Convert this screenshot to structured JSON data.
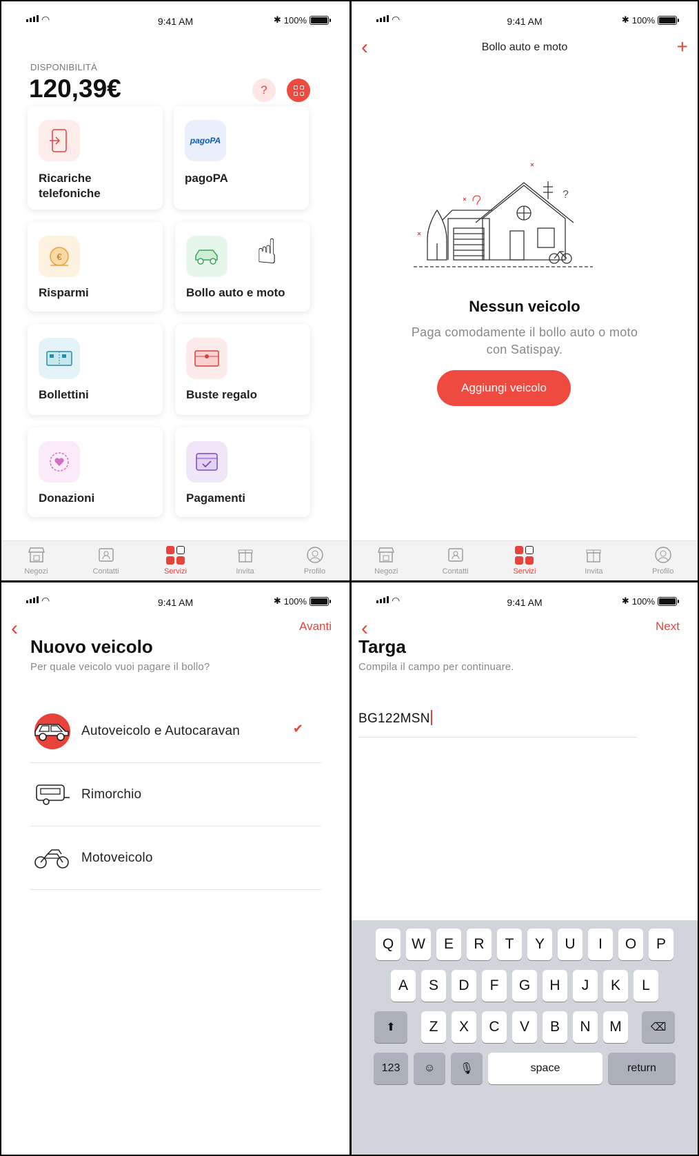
{
  "status_bar": {
    "time": "9:41 AM",
    "battery": "100%",
    "bluetooth": "✱"
  },
  "screen1": {
    "balance_label": "DISPONIBILITÀ",
    "balance_amount": "120,39€",
    "help_label": "?",
    "cards": [
      {
        "label_line1": "Ricariche",
        "label_line2": "telefoniche",
        "icon": "phone-recharge-icon"
      },
      {
        "label_line1": "pagoPA",
        "label_line2": "",
        "icon": "pagopa-logo",
        "logo_text": "pagoPA"
      },
      {
        "label_line1": "Risparmi",
        "label_line2": "",
        "icon": "savings-coin-icon"
      },
      {
        "label_line1": "Bollo auto e moto",
        "label_line2": "",
        "icon": "car-icon"
      },
      {
        "label_line1": "Bollettini",
        "label_line2": "",
        "icon": "bill-slip-icon"
      },
      {
        "label_line1": "Buste regalo",
        "label_line2": "",
        "icon": "gift-envelope-icon"
      },
      {
        "label_line1": "Donazioni",
        "label_line2": "",
        "icon": "heart-donation-icon"
      },
      {
        "label_line1": "Pagamenti",
        "label_line2": "",
        "icon": "calendar-payment-icon"
      }
    ]
  },
  "tabs": [
    {
      "label": "Negozi",
      "icon": "shop-icon"
    },
    {
      "label": "Contatti",
      "icon": "contacts-icon"
    },
    {
      "label": "Servizi",
      "icon": "services-icon",
      "active": true
    },
    {
      "label": "Invita",
      "icon": "gift-icon"
    },
    {
      "label": "Profilo",
      "icon": "profile-icon"
    }
  ],
  "screen2": {
    "title": "Bollo auto e moto",
    "empty_title": "Nessun veicolo",
    "empty_desc_line1": "Paga comodamente il bollo auto o moto",
    "empty_desc_line2": "con Satispay.",
    "add_button": "Aggiungi veicolo"
  },
  "screen3": {
    "next_label": "Avanti",
    "title": "Nuovo veicolo",
    "subtitle": "Per quale veicolo vuoi pagare il bollo?",
    "vehicles": [
      {
        "label": "Autoveicolo e Autocaravan",
        "icon": "car-icon",
        "selected": true
      },
      {
        "label": "Rimorchio",
        "icon": "trailer-icon",
        "selected": false
      },
      {
        "label": "Motoveicolo",
        "icon": "motorbike-icon",
        "selected": false
      }
    ],
    "check_mark": "✔"
  },
  "screen4": {
    "next_label": "Next",
    "title": "Targa",
    "subtitle": "Compila il campo per continuare.",
    "plate_value": "BG122MSN",
    "keyboard": {
      "row1": [
        "Q",
        "W",
        "E",
        "R",
        "T",
        "Y",
        "U",
        "I",
        "O",
        "P"
      ],
      "row2": [
        "A",
        "S",
        "D",
        "F",
        "G",
        "H",
        "J",
        "K",
        "L"
      ],
      "row3": [
        "Z",
        "X",
        "C",
        "V",
        "B",
        "N",
        "M"
      ],
      "numbers_key": "123",
      "space_key": "space",
      "return_key": "return"
    }
  },
  "colors": {
    "accent": "#ef4a40",
    "text": "#111111",
    "muted": "#888888"
  }
}
